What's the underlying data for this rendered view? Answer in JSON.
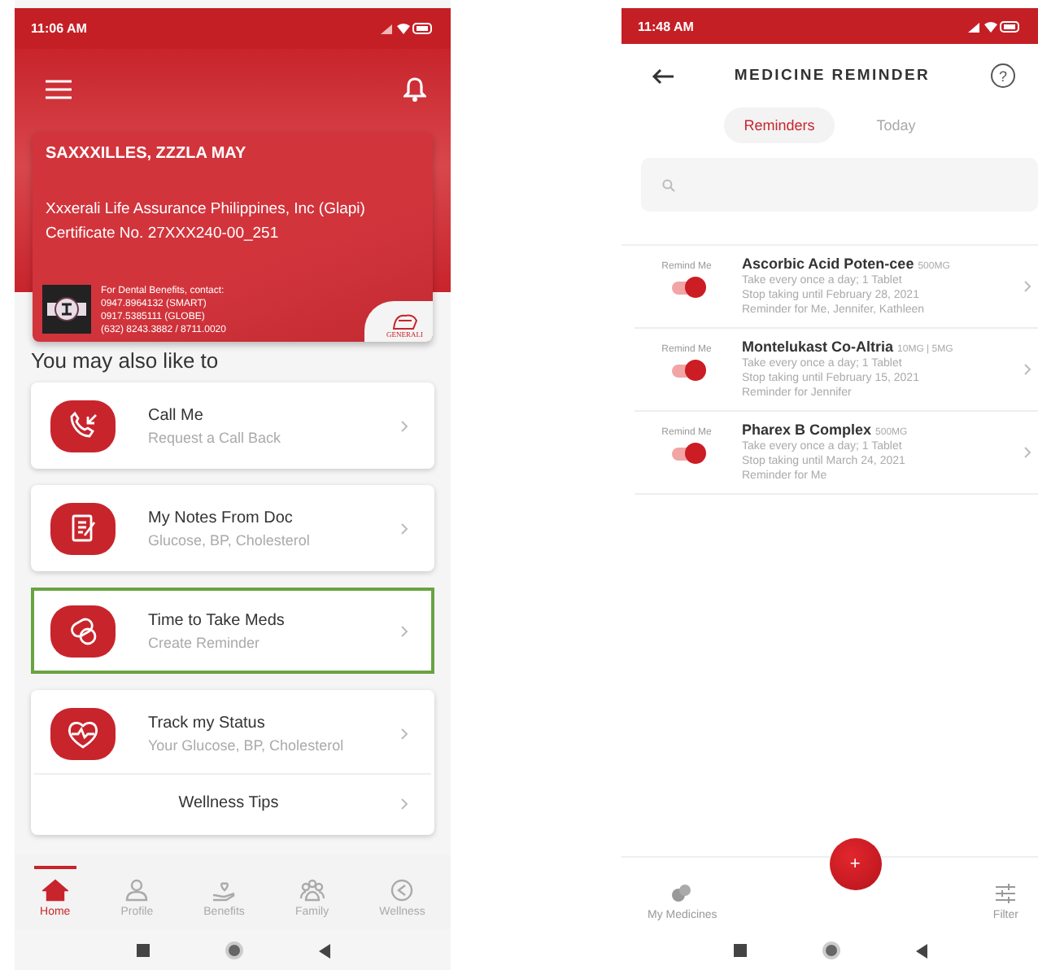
{
  "home_screen": {
    "status_time": "11:06 AM",
    "member_card": {
      "name": "SAXXXILLES, ZZZLA MAY",
      "company": "Xxxerali Life Assurance Philippines, Inc (Glapi)",
      "certificate": "Certificate No. 27XXX240-00_251",
      "dental_lines": [
        "For Dental Benefits, contact:",
        "0947.8964132 (SMART)",
        "0917.5385111 (GLOBE)",
        "(632) 8243.3882 / 8711.0020"
      ],
      "brand": "GENERALI"
    },
    "section_title": "You may also like to",
    "features": [
      {
        "kind": "phone",
        "title": "Call Me",
        "subtitle": "Request a Call Back",
        "highlighted": false
      },
      {
        "kind": "notes",
        "title": "My Notes From Doc",
        "subtitle": "Glucose, BP, Cholesterol",
        "highlighted": false
      },
      {
        "kind": "pills",
        "title": "Time to Take Meds",
        "subtitle": "Create Reminder",
        "highlighted": true
      },
      {
        "kind": "heart",
        "title": "Track my Status",
        "subtitle": "Your Glucose, BP, Cholesterol",
        "highlighted": false
      }
    ],
    "wellness_tips": "Wellness Tips",
    "nav": [
      {
        "kind": "home",
        "label": "Home",
        "selected": true
      },
      {
        "kind": "profile",
        "label": "Profile",
        "selected": false
      },
      {
        "kind": "benefits",
        "label": "Benefits",
        "selected": false
      },
      {
        "kind": "family",
        "label": "Family",
        "selected": false
      },
      {
        "kind": "wellness",
        "label": "Wellness",
        "selected": false
      }
    ]
  },
  "reminder_screen": {
    "status_time": "11:48 AM",
    "title": "MEDICINE REMINDER",
    "help": "?",
    "tabs": [
      {
        "label": "Reminders",
        "selected": true
      },
      {
        "label": "Today",
        "selected": false
      }
    ],
    "reminders": [
      {
        "remind_label": "Remind Me",
        "on": true,
        "name": "Ascorbic Acid Poten-cee",
        "dose": "500MG",
        "lines": [
          "Take every once a day; 1 Tablet",
          "Stop taking until February 28, 2021",
          "Reminder for Me, Jennifer, Kathleen"
        ]
      },
      {
        "remind_label": "Remind Me",
        "on": true,
        "name": "Montelukast Co-Altria",
        "dose": "10MG | 5MG",
        "lines": [
          "Take every once a day; 1 Tablet",
          "Stop taking until February 15, 2021",
          "Reminder for Jennifer"
        ]
      },
      {
        "remind_label": "Remind Me",
        "on": true,
        "name": "Pharex B Complex",
        "dose": "500MG",
        "lines": [
          "Take every once a day; 1 Tablet",
          "Stop taking until March 24, 2021",
          "Reminder for Me"
        ]
      }
    ],
    "add_button": "+",
    "bottom_left": "My Medicines",
    "bottom_right": "Filter"
  }
}
